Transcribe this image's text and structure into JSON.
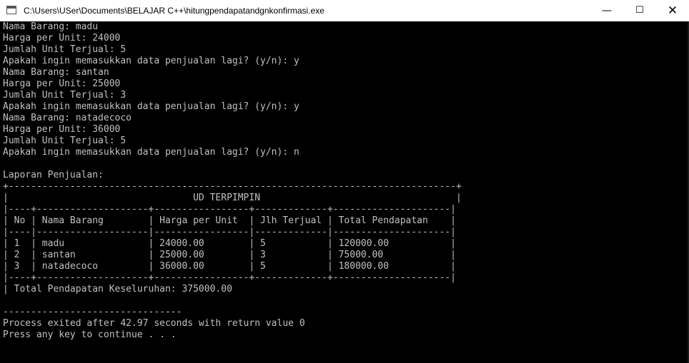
{
  "window": {
    "title": "C:\\Users\\USer\\Documents\\BELAJAR C++\\hitungpendapatandgnkonfirmasi.exe",
    "minimize_glyph": "—",
    "maximize_glyph": "☐",
    "close_glyph": "✕"
  },
  "console": {
    "lines": [
      "Nama Barang: madu",
      "Harga per Unit: 24000",
      "Jumlah Unit Terjual: 5",
      "Apakah ingin memasukkan data penjualan lagi? (y/n): y",
      "Nama Barang: santan",
      "Harga per Unit: 25000",
      "Jumlah Unit Terjual: 3",
      "Apakah ingin memasukkan data penjualan lagi? (y/n): y",
      "Nama Barang: natadecoco",
      "Harga per Unit: 36000",
      "Jumlah Unit Terjual: 5",
      "Apakah ingin memasukkan data penjualan lagi? (y/n): n",
      "",
      "Laporan Penjualan:",
      "+--------------------------------------------------------------------------------+",
      "|                                 UD TERPIMPIN                                   |",
      "|----+--------------------+-----------------+-------------+---------------------|",
      "| No | Nama Barang        | Harga per Unit  | Jlh Terjual | Total Pendapatan    |",
      "|----|--------------------|-----------------|-------------|---------------------|",
      "| 1  | madu               | 24000.00        | 5           | 120000.00           |",
      "| 2  | santan             | 25000.00        | 3           | 75000.00            |",
      "| 3  | natadecoco         | 36000.00        | 5           | 180000.00           |",
      "|----+--------------------+-----------------+-------------+---------------------|",
      "| Total Pendapatan Keseluruhan: 375000.00",
      "",
      "--------------------------------",
      "Process exited after 42.97 seconds with return value 0",
      "Press any key to continue . . ."
    ]
  }
}
